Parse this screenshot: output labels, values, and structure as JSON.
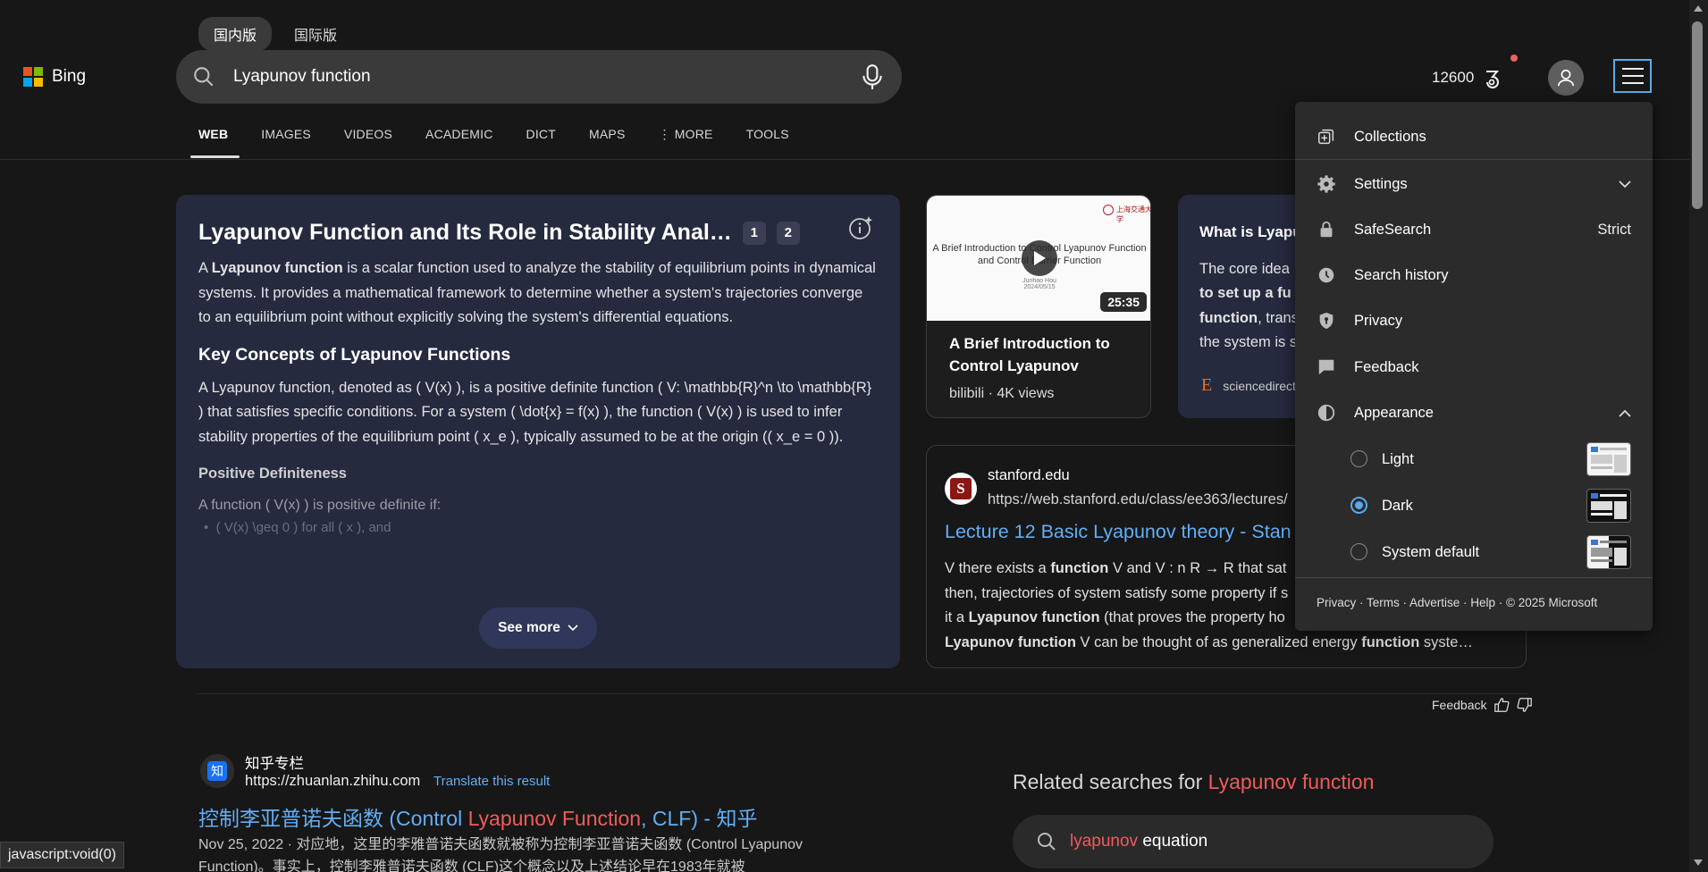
{
  "header": {
    "logo_text": "Bing",
    "region_tabs": [
      "国内版",
      "国际版"
    ],
    "search_value": "Lyapunov function",
    "nav": [
      "WEB",
      "IMAGES",
      "VIDEOS",
      "ACADEMIC",
      "DICT",
      "MAPS",
      "MORE",
      "TOOLS"
    ],
    "points": "12600"
  },
  "answer": {
    "title": "Lyapunov Function and Its Role in Stability Anal…",
    "citations": [
      "1",
      "2"
    ],
    "p1_prefix": "A ",
    "p1_bold": "Lyapunov function",
    "p1_rest": " is a scalar function used to analyze the stability of equilibrium points in dynamical systems. It provides a mathematical framework to determine whether a system's trajectories converge to an equilibrium point without explicitly solving the system's differential equations.",
    "h_key": "Key Concepts of Lyapunov Functions",
    "p2": "A Lyapunov function, denoted as ( V(x) ), is a positive definite function ( V: \\mathbb{R}^n \\to \\mathbb{R} ) that satisfies specific conditions. For a system ( \\dot{x} = f(x) ), the function ( V(x) ) is used to infer stability properties of the equilibrium point ( x_e ), typically assumed to be at the origin (( x_e = 0 )).",
    "h_pos": "Positive Definiteness",
    "p3": "A function ( V(x) ) is positive definite if:",
    "bullet": "( V(x) \\geq 0 ) for all ( x ), and",
    "see_more": "See more"
  },
  "video": {
    "slide_title": "A Brief Introduction to Control Lyapunov Function and Control Barrier Function",
    "slide_author": "Junhao Hou",
    "slide_date": "2024/05/15",
    "seal_text": "上海交通大学",
    "duration": "25:35",
    "title": "A Brief Introduction to Control Lyapunov",
    "meta": "bilibili · 4K views"
  },
  "what_card": {
    "title": "What is Lyapu",
    "line1": "The core idea",
    "line2_bold": "to set up a fu",
    "line3_bold": "function",
    "line3_rest": ", trans",
    "line4": "the system is s",
    "source": "sciencedirect"
  },
  "stanford": {
    "site": "stanford.edu",
    "url": "https://web.stanford.edu/class/ee363/lectures/",
    "title": "Lecture 12 Basic Lyapunov theory - Stan",
    "s1a": "V there exists a ",
    "s1b": "function",
    "s1c": " V and V : n R → R that sat",
    "s2": "then, trajectories of system satisfy some property if s",
    "s3a": "it a ",
    "s3b": "Lyapunov function",
    "s3c": " (that proves the property ho",
    "s4a": "Lyapunov function",
    "s4b": " V can be thought of as generalized energy ",
    "s4c": "function",
    "s4d": " syste…"
  },
  "feedback_label": "Feedback",
  "zhihu": {
    "logo": "知",
    "site": "知乎专栏",
    "url": "https://zhuanlan.zhihu.com",
    "translate": "Translate this result",
    "title_a": "控制李亚普诺夫函数 (Control ",
    "title_hl": "Lyapunov Function",
    "title_b": ", CLF) - 知乎",
    "snippet": "Nov 25, 2022 · 对应地，这里的李雅普诺夫函数就被称为控制李亚普诺夫函数 (Control Lyapunov Function)。事实上，控制李雅普诺夫函数 (CLF)这个概念以及上述结论早在1983年就被"
  },
  "related": {
    "heading_a": "Related searches for ",
    "heading_hl": "Lyapunov function",
    "item_hl": "lyapunov",
    "item_rest": " equation"
  },
  "status_bar": "javascript:void(0)",
  "menu": {
    "collections": "Collections",
    "settings": "Settings",
    "safesearch": "SafeSearch",
    "safesearch_value": "Strict",
    "history": "Search history",
    "privacy": "Privacy",
    "feedback": "Feedback",
    "appearance": "Appearance",
    "themes": [
      {
        "label": "Light",
        "selected": false
      },
      {
        "label": "Dark",
        "selected": true
      },
      {
        "label": "System default",
        "selected": false
      }
    ],
    "footer": "Privacy · Terms · Advertise · Help · © 2025 Microsoft"
  },
  "colors": {
    "accent_blue": "#63aef4",
    "highlight_red": "#f05b5b",
    "answer_bg": "#252a3f"
  }
}
